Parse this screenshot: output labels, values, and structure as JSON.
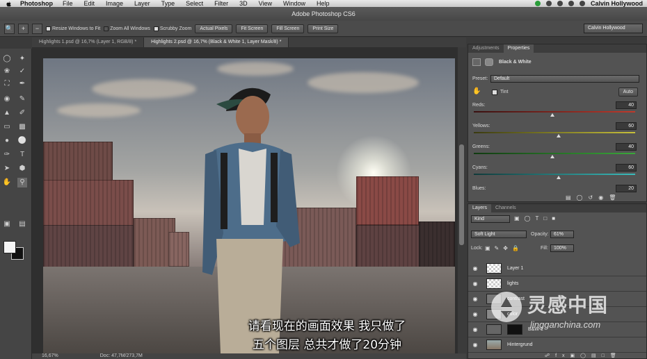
{
  "menubar": {
    "app": "Photoshop",
    "items": [
      "File",
      "Edit",
      "Image",
      "Layer",
      "Type",
      "Select",
      "Filter",
      "3D",
      "View",
      "Window",
      "Help"
    ],
    "user": "Calvin Hollywood"
  },
  "window": {
    "title": "Adobe Photoshop CS6"
  },
  "options": {
    "resize_windows": "Resize Windows to Fit",
    "zoom_all": "Zoom All Windows",
    "scrubby": "Scrubby Zoom",
    "actual_pixels": "Actual Pixels",
    "fit_screen": "Fit Screen",
    "fill_screen": "Fill Screen",
    "print_size": "Print Size",
    "workspace": "Calvin Hollywood"
  },
  "tabs": [
    {
      "label": "Highlights 1.psd @ 16,7% (Layer 1, RGB/8) *"
    },
    {
      "label": "Highlights 2.psd @ 16,7% (Black & White 1, Layer Mask/8) *"
    }
  ],
  "status": {
    "zoom": "16,67%",
    "doc": "Doc: 47,7M/273,7M"
  },
  "properties": {
    "tabs": [
      "Adjustments",
      "Properties"
    ],
    "title": "Black & White",
    "preset_label": "Preset:",
    "preset_value": "Default",
    "tint": "Tint",
    "auto": "Auto",
    "sliders": [
      {
        "label": "Reds:",
        "value": "40",
        "pos": 0.51,
        "color": "#c0392b"
      },
      {
        "label": "Yellows:",
        "value": "60",
        "pos": 0.55,
        "color": "#c8c03a"
      },
      {
        "label": "Greens:",
        "value": "40",
        "pos": 0.51,
        "color": "#3aa83a"
      },
      {
        "label": "Cyans:",
        "value": "60",
        "pos": 0.55,
        "color": "#3abcbc"
      },
      {
        "label": "Blues:",
        "value": "20"
      }
    ]
  },
  "layers": {
    "tabs": [
      "Layers",
      "Channels"
    ],
    "kind": "Kind",
    "blend": "Soft Light",
    "opacity_label": "Opacity:",
    "opacity": "61%",
    "lock_label": "Lock:",
    "fill_label": "Fill:",
    "fill": "100%",
    "items": [
      {
        "name": "Layer 1"
      },
      {
        "name": "lights"
      },
      {
        "name": "contrast"
      },
      {
        "name": "color"
      },
      {
        "name": "B&W 1"
      },
      {
        "name": "Hintergrund"
      }
    ]
  },
  "subtitle": {
    "line1": "请看现在的画面效果 我只做了",
    "line2": "五个图层 总共才做了20分钟"
  },
  "watermark": {
    "cn": "灵感中国",
    "url": "lingganchina.com"
  }
}
